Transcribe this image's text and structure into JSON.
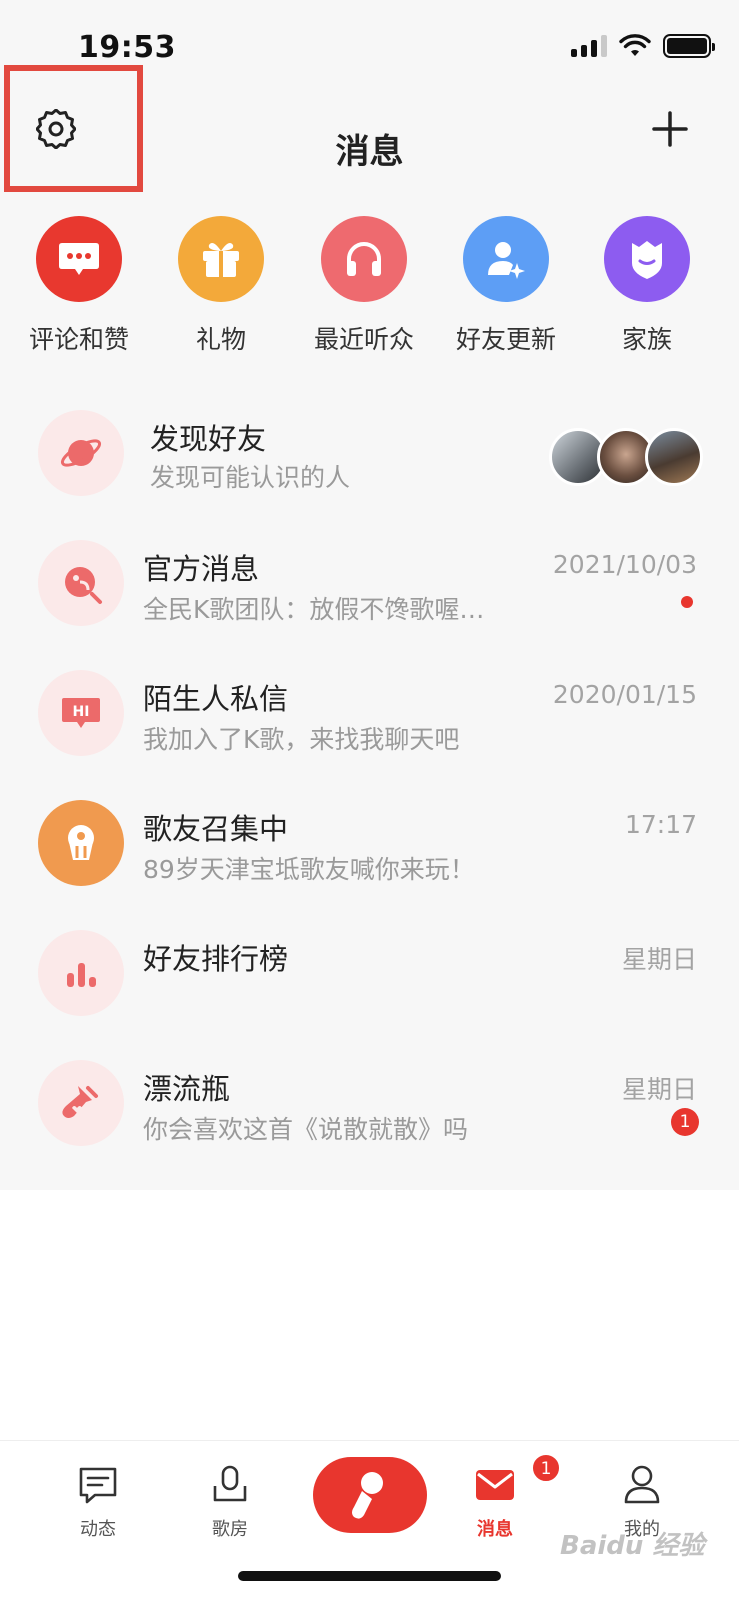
{
  "status_bar": {
    "time": "19:53"
  },
  "header": {
    "title": "消息",
    "settings_icon": "gear-icon",
    "add_icon": "plus-icon"
  },
  "quick_actions": [
    {
      "label": "评论和赞",
      "icon": "comment-icon",
      "color": "#e8382f"
    },
    {
      "label": "礼物",
      "icon": "gift-icon",
      "color": "#f3a93a"
    },
    {
      "label": "最近听众",
      "icon": "headphones-icon",
      "color": "#ee6a6f"
    },
    {
      "label": "好友更新",
      "icon": "user-update-icon",
      "color": "#5d9ef5"
    },
    {
      "label": "家族",
      "icon": "family-shield-icon",
      "color": "#8d5cf0"
    }
  ],
  "messages": [
    {
      "title": "发现好友",
      "subtitle": "发现可能认识的人",
      "time": "",
      "icon": "planet-icon"
    },
    {
      "title": "官方消息",
      "subtitle": "全民K歌团队：放假不馋歌喔…",
      "time": "2021/10/03",
      "icon": "official-icon",
      "unread_dot": true
    },
    {
      "title": "陌生人私信",
      "subtitle": "我加入了K歌，来找我聊天吧",
      "time": "2020/01/15",
      "icon": "hi-icon"
    },
    {
      "title": "歌友召集中",
      "subtitle": "89岁天津宝坻歌友喊你来玩！",
      "time": "17:17",
      "icon": "balloon-icon",
      "icon_color": "#f09a4f"
    },
    {
      "title": "好友排行榜",
      "subtitle": "",
      "time": "星期日",
      "icon": "bar-chart-icon"
    },
    {
      "title": "漂流瓶",
      "subtitle": "你会喜欢这首《说散就散》吗",
      "time": "星期日",
      "icon": "bottle-icon",
      "badge": "1"
    }
  ],
  "tabbar": {
    "tabs": [
      {
        "label": "动态",
        "icon": "feed-icon"
      },
      {
        "label": "歌房",
        "icon": "mic-room-icon"
      },
      {
        "label": "消息",
        "icon": "mail-icon",
        "badge": "1",
        "active": true
      },
      {
        "label": "我的",
        "icon": "profile-icon"
      }
    ],
    "record_icon": "sing-icon"
  },
  "watermark": "Baidu 经验",
  "accent_color": "#e8362e"
}
